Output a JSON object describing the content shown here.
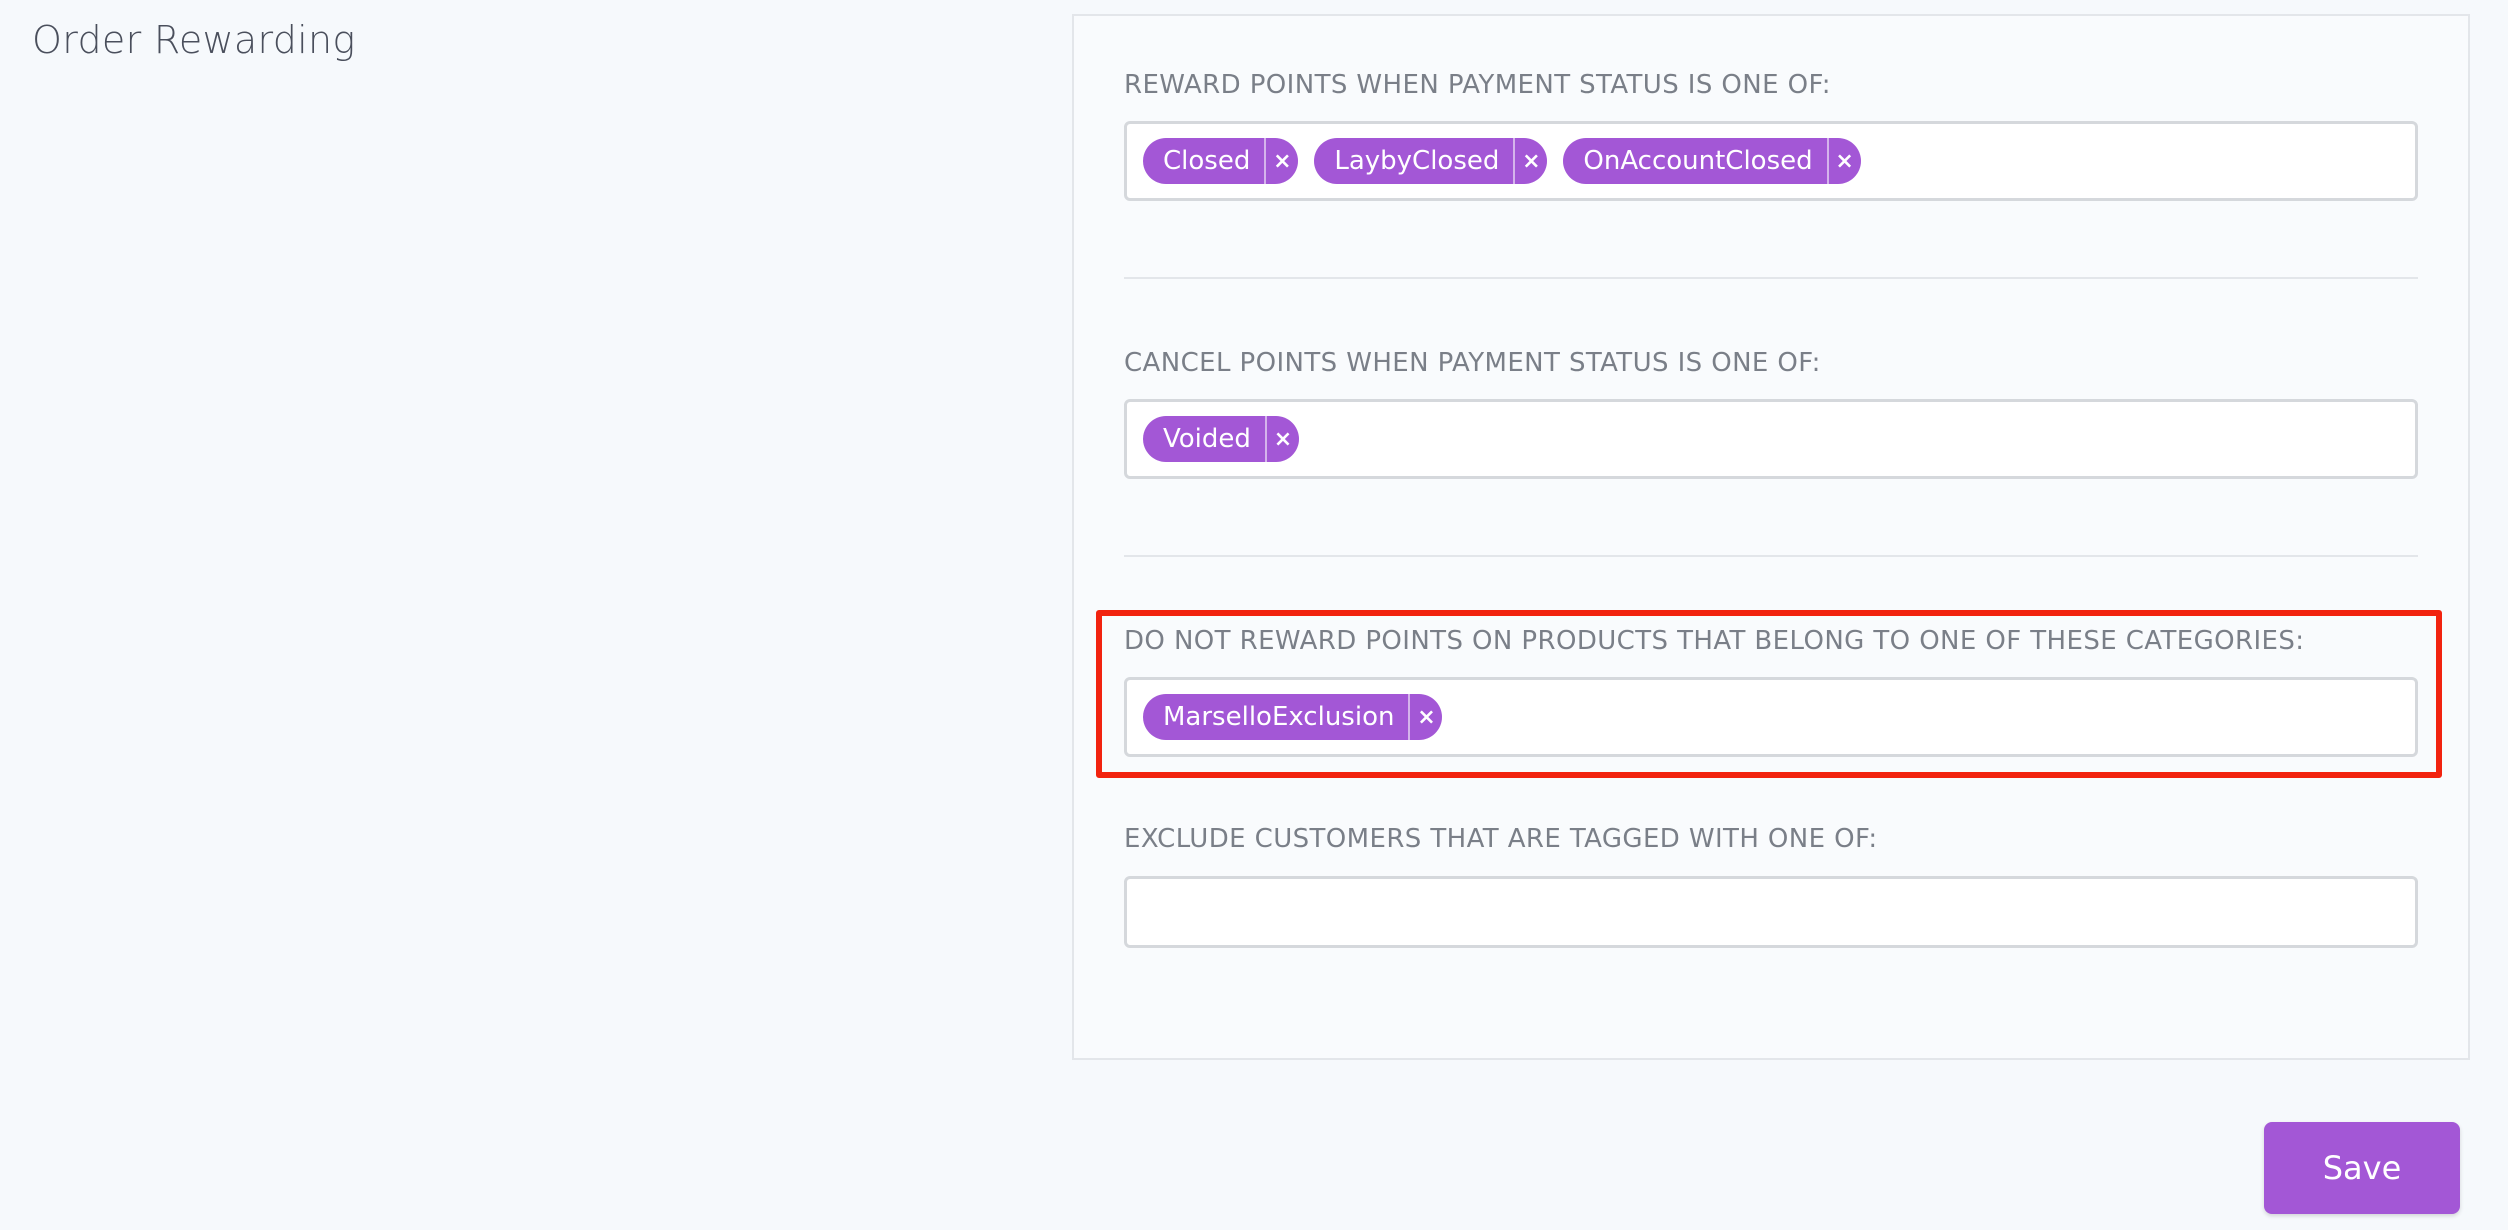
{
  "page": {
    "title": "Order Rewarding"
  },
  "fields": {
    "reward_status": {
      "label": "REWARD POINTS WHEN PAYMENT STATUS IS ONE OF:",
      "tags": [
        "Closed",
        "LaybyClosed",
        "OnAccountClosed"
      ]
    },
    "cancel_status": {
      "label": "CANCEL POINTS WHEN PAYMENT STATUS IS ONE OF:",
      "tags": [
        "Voided"
      ]
    },
    "excluded_categories": {
      "label": "DO NOT REWARD POINTS ON PRODUCTS THAT BELONG TO ONE OF THESE CATEGORIES:",
      "tags": [
        "MarselloExclusion"
      ]
    },
    "excluded_customers": {
      "label": "EXCLUDE CUSTOMERS THAT ARE TAGGED WITH ONE OF:",
      "tags": []
    }
  },
  "tag_remove_glyph": "×",
  "save_label": "Save",
  "colors": {
    "accent": "#a357d6",
    "highlight": "#f2230f",
    "background": "#f6f9fc"
  }
}
